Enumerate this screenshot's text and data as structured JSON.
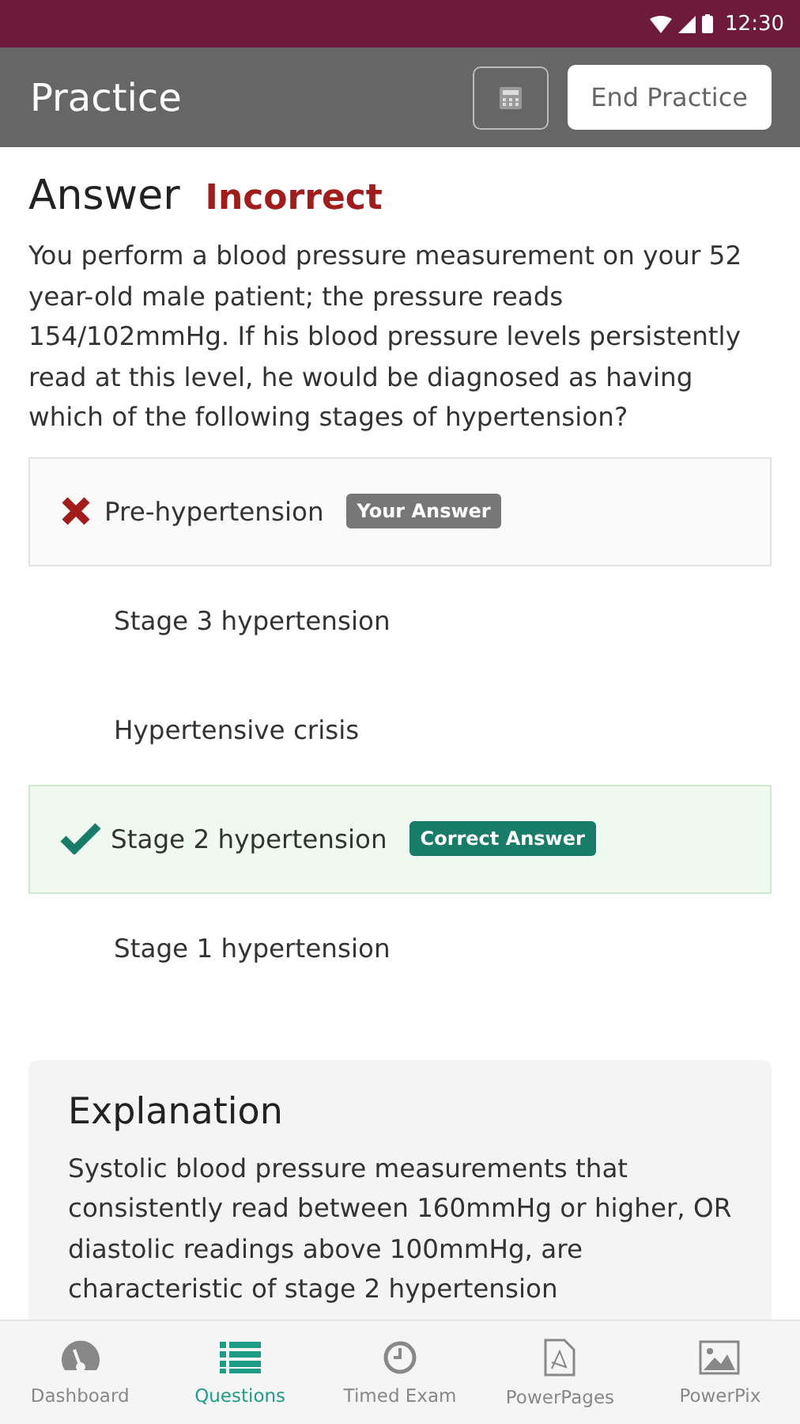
{
  "status_bar": {
    "time": "12:30"
  },
  "app_bar": {
    "title": "Practice",
    "end_button": "End Practice"
  },
  "answer": {
    "heading": "Answer",
    "result": "Incorrect"
  },
  "question": "You perform a blood pressure measurement on your 52 year-old male patient; the pressure reads 154/102mmHg. If his blood pressure levels persistently read at this level, he would be diagnosed as having which of the following stages of hypertension?",
  "options": [
    {
      "text": "Pre-hypertension",
      "selected": true,
      "correct": false,
      "badge": "Your Answer"
    },
    {
      "text": "Stage 3 hypertension",
      "selected": false,
      "correct": false
    },
    {
      "text": "Hypertensive crisis",
      "selected": false,
      "correct": false
    },
    {
      "text": "Stage 2 hypertension",
      "selected": false,
      "correct": true,
      "badge": "Correct Answer"
    },
    {
      "text": "Stage 1 hypertension",
      "selected": false,
      "correct": false
    }
  ],
  "explanation": {
    "title": "Explanation",
    "text": "Systolic blood pressure measurements that consistently read between 160mmHg or higher, OR diastolic readings above 100mmHg, are characteristic of stage 2 hypertension"
  },
  "bottom_nav": [
    {
      "label": "Dashboard",
      "kind": "gauge",
      "selected": false
    },
    {
      "label": "Questions",
      "kind": "list",
      "selected": true
    },
    {
      "label": "Timed Exam",
      "kind": "clock",
      "selected": false
    },
    {
      "label": "PowerPages",
      "kind": "document",
      "selected": false
    },
    {
      "label": "PowerPix",
      "kind": "image",
      "selected": false
    }
  ]
}
